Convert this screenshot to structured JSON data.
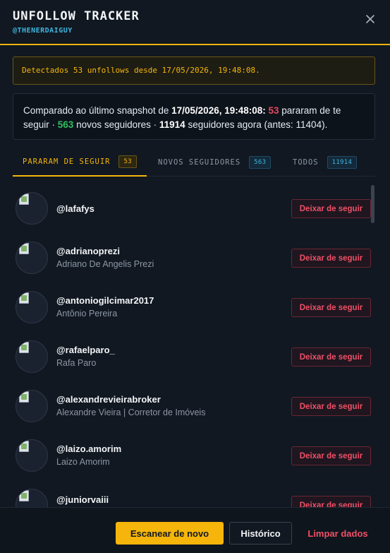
{
  "header": {
    "title": "UNFOLLOW TRACKER",
    "handle": "@THENERDAIGUY",
    "close_icon": "close-icon"
  },
  "alert": {
    "text": "Detectados 53 unfollows desde 17/05/2026, 19:48:08."
  },
  "summary": {
    "prefix": "Comparado ao último snapshot de ",
    "snapshot_date": "17/05/2026, 19:48:08",
    "colon": ": ",
    "unfollows": "53",
    "unfollows_text": " pararam de te seguir · ",
    "new_followers": "563",
    "new_followers_text": " novos seguidores · ",
    "total": "11914",
    "total_text": " seguidores agora (antes: 11404)."
  },
  "tabs": [
    {
      "label": "PARARAM DE SEGUIR",
      "count": "53",
      "active": true
    },
    {
      "label": "NOVOS SEGUIDORES",
      "count": "563",
      "active": false
    },
    {
      "label": "TODOS",
      "count": "11914",
      "active": false
    }
  ],
  "users": [
    {
      "username": "@lafafys",
      "name": "",
      "action": "Deixar de seguir"
    },
    {
      "username": "@adrianoprezi",
      "name": "Adriano De Angelis Prezi",
      "action": "Deixar de seguir"
    },
    {
      "username": "@antoniogilcimar2017",
      "name": "Antônio Pereira",
      "action": "Deixar de seguir"
    },
    {
      "username": "@rafaelparo_",
      "name": "Rafa Paro",
      "action": "Deixar de seguir"
    },
    {
      "username": "@alexandrevieirabroker",
      "name": "Alexandre Vieira | Corretor de Imóveis",
      "action": "Deixar de seguir"
    },
    {
      "username": "@laizo.amorim",
      "name": "Laizo Amorim",
      "action": "Deixar de seguir"
    },
    {
      "username": "@juniorvaiii",
      "name": "",
      "action": "Deixar de seguir"
    }
  ],
  "footer": {
    "scan_label": "Escanear de novo",
    "history_label": "Histórico",
    "clear_label": "Limpar dados"
  },
  "colors": {
    "accent": "#f5b50b",
    "danger": "#ee5066",
    "success": "#2fbf61",
    "info": "#3fb6e0",
    "background": "#111821"
  }
}
